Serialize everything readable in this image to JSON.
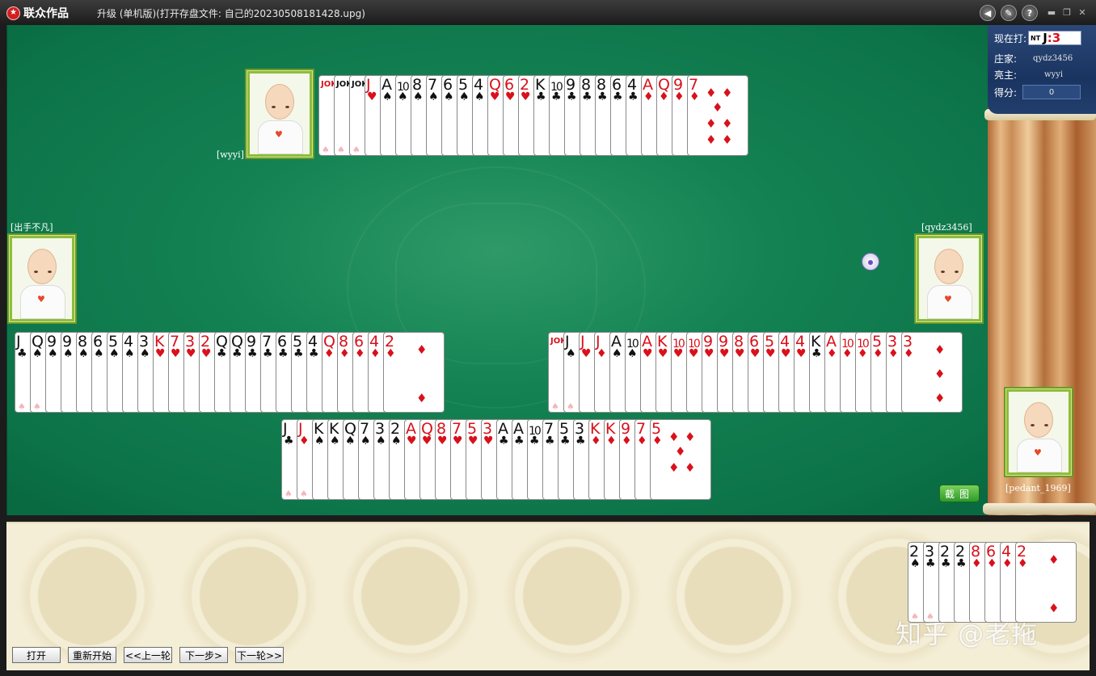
{
  "window": {
    "brand": "联众作品",
    "title": "升级 (单机版)(打开存盘文件: 自己的20230508181428.upg)"
  },
  "status": {
    "current_label": "现在打:",
    "trump_nt": "NT",
    "trump_value": "J",
    "trump_suffix": ":3",
    "dealer_label": "庄家:",
    "dealer_value": "qydz3456",
    "declarer_label": "亮主:",
    "declarer_value": "wyyi",
    "score_label": "得分:",
    "score_value": "0"
  },
  "players": {
    "north": {
      "name": "[wyyi]"
    },
    "west": {
      "name": "[出手不凡]"
    },
    "east": {
      "name": "[qydz3456]"
    },
    "south": {
      "name": "[pedant_1969]"
    }
  },
  "hands": {
    "north": [
      {
        "rank": "JOKER",
        "suit": "",
        "color": "red"
      },
      {
        "rank": "JOKER",
        "suit": "",
        "color": "black"
      },
      {
        "rank": "JOKER",
        "suit": "",
        "color": "black"
      },
      {
        "rank": "J",
        "suit": "♥",
        "color": "red"
      },
      {
        "rank": "A",
        "suit": "♠",
        "color": "black"
      },
      {
        "rank": "10",
        "suit": "♠",
        "color": "black"
      },
      {
        "rank": "8",
        "suit": "♠",
        "color": "black"
      },
      {
        "rank": "7",
        "suit": "♠",
        "color": "black"
      },
      {
        "rank": "6",
        "suit": "♠",
        "color": "black"
      },
      {
        "rank": "5",
        "suit": "♠",
        "color": "black"
      },
      {
        "rank": "4",
        "suit": "♠",
        "color": "black"
      },
      {
        "rank": "Q",
        "suit": "♥",
        "color": "red"
      },
      {
        "rank": "6",
        "suit": "♥",
        "color": "red"
      },
      {
        "rank": "2",
        "suit": "♥",
        "color": "red"
      },
      {
        "rank": "K",
        "suit": "♣",
        "color": "black"
      },
      {
        "rank": "10",
        "suit": "♣",
        "color": "black"
      },
      {
        "rank": "9",
        "suit": "♣",
        "color": "black"
      },
      {
        "rank": "8",
        "suit": "♣",
        "color": "black"
      },
      {
        "rank": "8",
        "suit": "♣",
        "color": "black"
      },
      {
        "rank": "6",
        "suit": "♣",
        "color": "black"
      },
      {
        "rank": "4",
        "suit": "♣",
        "color": "black"
      },
      {
        "rank": "A",
        "suit": "♦",
        "color": "red"
      },
      {
        "rank": "Q",
        "suit": "♦",
        "color": "red"
      },
      {
        "rank": "9",
        "suit": "♦",
        "color": "red"
      },
      {
        "rank": "7",
        "suit": "♦",
        "color": "red"
      }
    ],
    "west": [
      {
        "rank": "J",
        "suit": "♣",
        "color": "black"
      },
      {
        "rank": "Q",
        "suit": "♠",
        "color": "black"
      },
      {
        "rank": "9",
        "suit": "♠",
        "color": "black"
      },
      {
        "rank": "9",
        "suit": "♠",
        "color": "black"
      },
      {
        "rank": "8",
        "suit": "♠",
        "color": "black"
      },
      {
        "rank": "6",
        "suit": "♠",
        "color": "black"
      },
      {
        "rank": "5",
        "suit": "♠",
        "color": "black"
      },
      {
        "rank": "4",
        "suit": "♠",
        "color": "black"
      },
      {
        "rank": "3",
        "suit": "♠",
        "color": "black"
      },
      {
        "rank": "K",
        "suit": "♥",
        "color": "red"
      },
      {
        "rank": "7",
        "suit": "♥",
        "color": "red"
      },
      {
        "rank": "3",
        "suit": "♥",
        "color": "red"
      },
      {
        "rank": "2",
        "suit": "♥",
        "color": "red"
      },
      {
        "rank": "Q",
        "suit": "♣",
        "color": "black"
      },
      {
        "rank": "Q",
        "suit": "♣",
        "color": "black"
      },
      {
        "rank": "9",
        "suit": "♣",
        "color": "black"
      },
      {
        "rank": "7",
        "suit": "♣",
        "color": "black"
      },
      {
        "rank": "6",
        "suit": "♣",
        "color": "black"
      },
      {
        "rank": "5",
        "suit": "♣",
        "color": "black"
      },
      {
        "rank": "4",
        "suit": "♣",
        "color": "black"
      },
      {
        "rank": "Q",
        "suit": "♦",
        "color": "red"
      },
      {
        "rank": "8",
        "suit": "♦",
        "color": "red"
      },
      {
        "rank": "6",
        "suit": "♦",
        "color": "red"
      },
      {
        "rank": "4",
        "suit": "♦",
        "color": "red"
      },
      {
        "rank": "2",
        "suit": "♦",
        "color": "red"
      }
    ],
    "east": [
      {
        "rank": "JOKER",
        "suit": "",
        "color": "red"
      },
      {
        "rank": "J",
        "suit": "♠",
        "color": "black"
      },
      {
        "rank": "J",
        "suit": "♥",
        "color": "red"
      },
      {
        "rank": "J",
        "suit": "♦",
        "color": "red"
      },
      {
        "rank": "A",
        "suit": "♠",
        "color": "black"
      },
      {
        "rank": "10",
        "suit": "♠",
        "color": "black"
      },
      {
        "rank": "A",
        "suit": "♥",
        "color": "red"
      },
      {
        "rank": "K",
        "suit": "♥",
        "color": "red"
      },
      {
        "rank": "10",
        "suit": "♥",
        "color": "red"
      },
      {
        "rank": "10",
        "suit": "♥",
        "color": "red"
      },
      {
        "rank": "9",
        "suit": "♥",
        "color": "red"
      },
      {
        "rank": "9",
        "suit": "♥",
        "color": "red"
      },
      {
        "rank": "8",
        "suit": "♥",
        "color": "red"
      },
      {
        "rank": "6",
        "suit": "♥",
        "color": "red"
      },
      {
        "rank": "5",
        "suit": "♥",
        "color": "red"
      },
      {
        "rank": "4",
        "suit": "♥",
        "color": "red"
      },
      {
        "rank": "4",
        "suit": "♥",
        "color": "red"
      },
      {
        "rank": "K",
        "suit": "♣",
        "color": "black"
      },
      {
        "rank": "A",
        "suit": "♦",
        "color": "red"
      },
      {
        "rank": "10",
        "suit": "♦",
        "color": "red"
      },
      {
        "rank": "10",
        "suit": "♦",
        "color": "red"
      },
      {
        "rank": "5",
        "suit": "♦",
        "color": "red"
      },
      {
        "rank": "3",
        "suit": "♦",
        "color": "red"
      },
      {
        "rank": "3",
        "suit": "♦",
        "color": "red"
      }
    ],
    "south": [
      {
        "rank": "J",
        "suit": "♣",
        "color": "black"
      },
      {
        "rank": "J",
        "suit": "♦",
        "color": "red"
      },
      {
        "rank": "K",
        "suit": "♠",
        "color": "black"
      },
      {
        "rank": "K",
        "suit": "♠",
        "color": "black"
      },
      {
        "rank": "Q",
        "suit": "♠",
        "color": "black"
      },
      {
        "rank": "7",
        "suit": "♠",
        "color": "black"
      },
      {
        "rank": "3",
        "suit": "♠",
        "color": "black"
      },
      {
        "rank": "2",
        "suit": "♠",
        "color": "black"
      },
      {
        "rank": "A",
        "suit": "♥",
        "color": "red"
      },
      {
        "rank": "Q",
        "suit": "♥",
        "color": "red"
      },
      {
        "rank": "8",
        "suit": "♥",
        "color": "red"
      },
      {
        "rank": "7",
        "suit": "♥",
        "color": "red"
      },
      {
        "rank": "5",
        "suit": "♥",
        "color": "red"
      },
      {
        "rank": "3",
        "suit": "♥",
        "color": "red"
      },
      {
        "rank": "A",
        "suit": "♣",
        "color": "black"
      },
      {
        "rank": "A",
        "suit": "♣",
        "color": "black"
      },
      {
        "rank": "10",
        "suit": "♣",
        "color": "black"
      },
      {
        "rank": "7",
        "suit": "♣",
        "color": "black"
      },
      {
        "rank": "5",
        "suit": "♣",
        "color": "black"
      },
      {
        "rank": "3",
        "suit": "♣",
        "color": "black"
      },
      {
        "rank": "K",
        "suit": "♦",
        "color": "red"
      },
      {
        "rank": "K",
        "suit": "♦",
        "color": "red"
      },
      {
        "rank": "9",
        "suit": "♦",
        "color": "red"
      },
      {
        "rank": "7",
        "suit": "♦",
        "color": "red"
      },
      {
        "rank": "5",
        "suit": "♦",
        "color": "red"
      }
    ],
    "kitty": [
      {
        "rank": "2",
        "suit": "♠",
        "color": "black"
      },
      {
        "rank": "3",
        "suit": "♣",
        "color": "black"
      },
      {
        "rank": "2",
        "suit": "♣",
        "color": "black"
      },
      {
        "rank": "2",
        "suit": "♣",
        "color": "black"
      },
      {
        "rank": "8",
        "suit": "♦",
        "color": "red"
      },
      {
        "rank": "6",
        "suit": "♦",
        "color": "red"
      },
      {
        "rank": "4",
        "suit": "♦",
        "color": "red"
      },
      {
        "rank": "2",
        "suit": "♦",
        "color": "red"
      }
    ]
  },
  "buttons": {
    "screenshot": "截图",
    "open": "打开",
    "restart": "重新开始",
    "prev_round": "<<上一轮",
    "next_step": "下一步>",
    "next_round": "下一轮>>"
  },
  "watermark": "知乎 @老拖",
  "icons": {
    "sound": "speaker-icon",
    "settings": "wrench-icon",
    "help": "question-icon",
    "logo": "star-logo-icon",
    "pet": "rabbit-icon"
  },
  "colors": {
    "table_green": "#148253",
    "card_red": "#d8111b",
    "card_black": "#111111",
    "avatar_border": "#8fbd3d",
    "panel_blue": "#1a3460"
  }
}
